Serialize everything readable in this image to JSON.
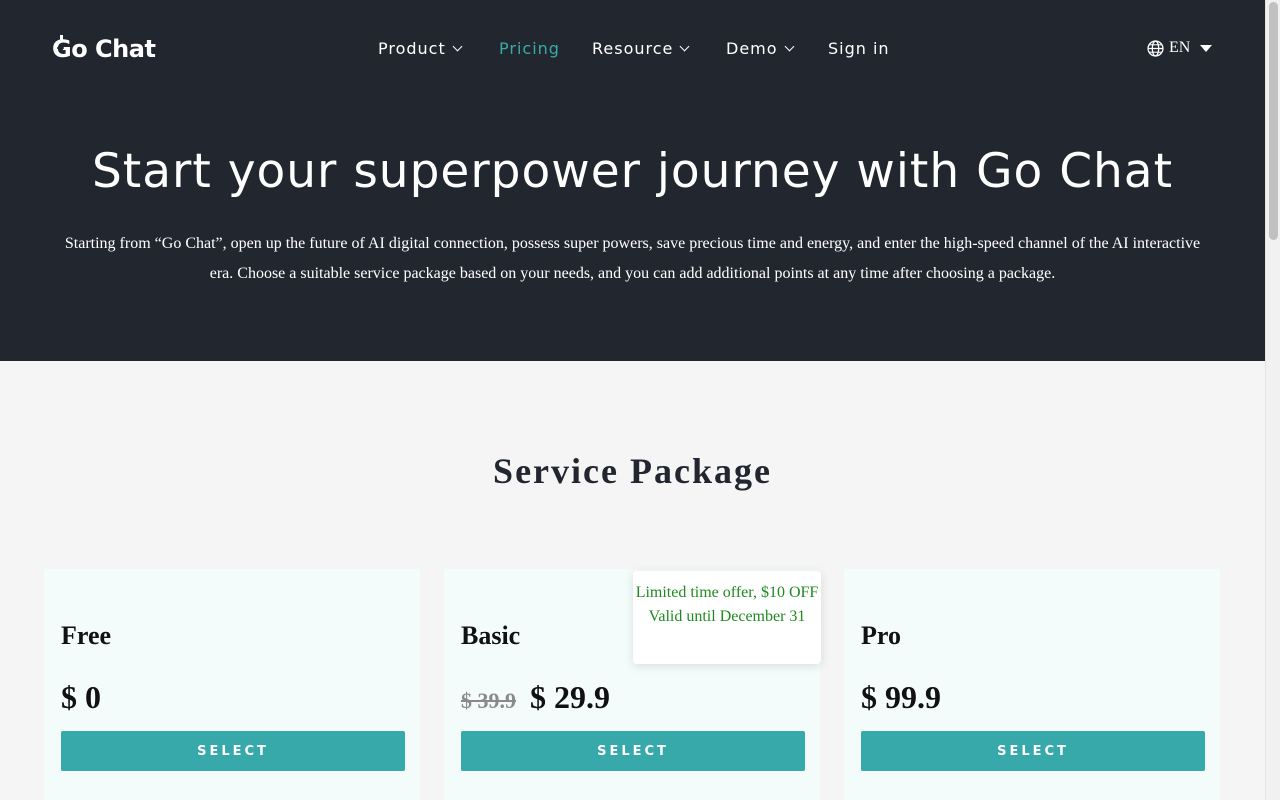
{
  "header": {
    "logo_text": "Go Chat",
    "nav": [
      {
        "label": "Product",
        "has_dropdown": true,
        "active": false
      },
      {
        "label": "Pricing",
        "has_dropdown": false,
        "active": true
      },
      {
        "label": "Resource",
        "has_dropdown": true,
        "active": false
      },
      {
        "label": "Demo",
        "has_dropdown": true,
        "active": false
      },
      {
        "label": "Sign in",
        "has_dropdown": false,
        "active": false
      }
    ],
    "language": {
      "icon": "globe-icon",
      "label": "EN"
    }
  },
  "hero": {
    "title": "Start your superpower journey with Go Chat",
    "subtitle": "Starting from “Go Chat”, open up the future of AI digital connection, possess super powers, save precious time and energy, and enter the high-speed channel of the AI interactive era. Choose a suitable service package based on your needs, and you can add additional points at any time after choosing a package."
  },
  "packages": {
    "section_title": "Service Package",
    "offer_badge": {
      "line1": "Limited time offer, $10 OFF",
      "line2": "Valid until December 31"
    },
    "cards": [
      {
        "name": "Free",
        "price": "$ 0",
        "old_price": "",
        "button": "SELECT"
      },
      {
        "name": "Basic",
        "price": "$ 29.9",
        "old_price": "$ 39.9",
        "button": "SELECT"
      },
      {
        "name": "Pro",
        "price": "$ 99.9",
        "old_price": "",
        "button": "SELECT"
      }
    ]
  },
  "colors": {
    "header_bg": "#22262f",
    "accent": "#38a9aa",
    "active_nav": "#3aaaa9",
    "card_bg": "#f3fcfb",
    "offer_text": "#1f8a1f"
  }
}
